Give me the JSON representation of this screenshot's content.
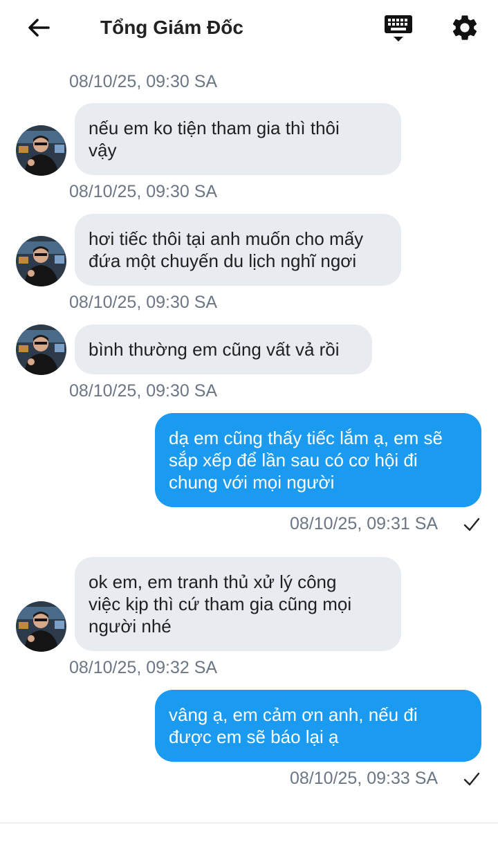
{
  "header": {
    "title": "Tổng Giám Đốc",
    "back_icon": "arrow-left-icon",
    "keyboard_icon": "keyboard-icon",
    "settings_icon": "gear-icon"
  },
  "messages": [
    {
      "side": "in",
      "text": "nếu em ko tiện tham gia thì thôi\nvậy",
      "time": "08/10/25, 09:30 SA"
    },
    {
      "side": "in",
      "text": "hơi tiếc thôi tại anh muốn cho mấy\nđứa một chuyến du lịch nghĩ ngơi",
      "time": "08/10/25, 09:30 SA"
    },
    {
      "side": "in",
      "text": "bình thường em cũng vất vả rồi",
      "time": "08/10/25, 09:30 SA"
    },
    {
      "side": "out",
      "text": "dạ em cũng thấy tiếc lắm ạ, em sẽ\nsắp xếp để lần sau có cơ hội đi\nchung với mọi người",
      "time": "08/10/25, 09:31 SA"
    },
    {
      "side": "in",
      "text": "ok em, em tranh thủ xử lý công\nviệc kịp thì cứ tham gia cũng mọi\nngười nhé",
      "time": "08/10/25, 09:32 SA"
    },
    {
      "side": "out",
      "text": "vâng ạ, em cảm ơn anh, nếu đi\nđược em sẽ báo lại ạ",
      "time": "08/10/25, 09:33 SA"
    }
  ],
  "top_time": "08/10/25, 09:30 SA",
  "colors": {
    "outgoing_bubble": "#1a9bf0",
    "incoming_bubble": "#e8ecf1",
    "timestamp": "#6b7785"
  }
}
